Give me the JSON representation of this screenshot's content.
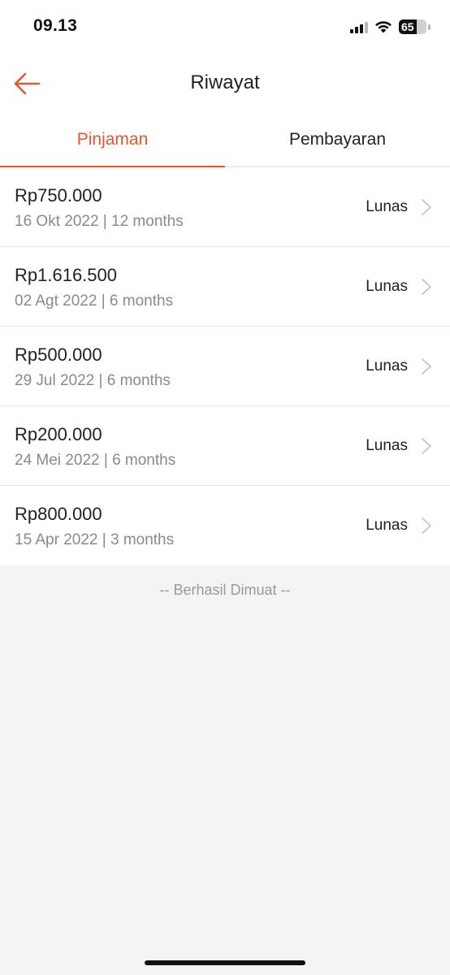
{
  "status_bar": {
    "time": "09.13",
    "battery": "65",
    "battery_level": 0.65
  },
  "header": {
    "title": "Riwayat",
    "back_icon": "arrow-left-icon",
    "accent_color": "#e4572e"
  },
  "tabs": [
    {
      "label": "Pinjaman",
      "active": true
    },
    {
      "label": "Pembayaran",
      "active": false
    }
  ],
  "loans": [
    {
      "amount": "Rp750.000",
      "meta": "16 Okt 2022 | 12 months",
      "status": "Lunas"
    },
    {
      "amount": "Rp1.616.500",
      "meta": "02 Agt 2022 | 6 months",
      "status": "Lunas"
    },
    {
      "amount": "Rp500.000",
      "meta": "29 Jul 2022 | 6 months",
      "status": "Lunas"
    },
    {
      "amount": "Rp200.000",
      "meta": "24 Mei 2022 | 6 months",
      "status": "Lunas"
    },
    {
      "amount": "Rp800.000",
      "meta": "15 Apr 2022 | 3 months",
      "status": "Lunas"
    }
  ],
  "footer_note": "-- Berhasil Dimuat --"
}
